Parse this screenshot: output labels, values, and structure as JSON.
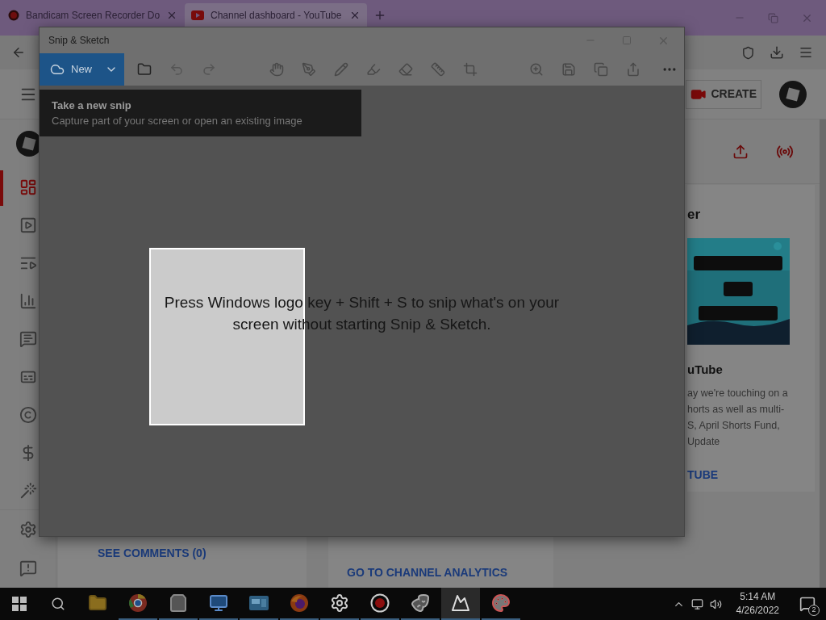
{
  "browser": {
    "tabs": [
      {
        "title": "Bandicam Screen Recorder Do",
        "kind": "record",
        "selected": false
      },
      {
        "title": "Channel dashboard - YouTube",
        "kind": "youtube",
        "selected": true
      }
    ]
  },
  "studio": {
    "create_button": "CREATE",
    "sidebar": [
      {
        "kind": "dashboard",
        "selected": true
      },
      {
        "kind": "content",
        "selected": false
      },
      {
        "kind": "playlists",
        "selected": false
      },
      {
        "kind": "analytics",
        "selected": false
      },
      {
        "kind": "comments",
        "selected": false
      },
      {
        "kind": "subtitles",
        "selected": false
      },
      {
        "kind": "copyright",
        "selected": false
      },
      {
        "kind": "earn",
        "selected": false
      },
      {
        "kind": "customization",
        "selected": false
      }
    ],
    "sidebar_bottom": [
      {
        "kind": "settings",
        "selected": false
      },
      {
        "kind": "feedback",
        "selected": false
      }
    ],
    "news_card": {
      "heading": "er",
      "video_title": "uTube",
      "lines": [
        "ay we're touching on a",
        "horts as well as multi-",
        "S, April Shorts Fund,",
        "Update"
      ],
      "link": "TUBE"
    },
    "comments_link": "SEE COMMENTS (0)",
    "analytics_link": "GO TO CHANNEL ANALYTICS"
  },
  "snip": {
    "title": "Snip & Sketch",
    "new_label": "New",
    "tooltip": {
      "title": "Take a new snip",
      "description": "Capture part of your screen or open an existing image"
    },
    "message": "Press Windows logo key + Shift + S to snip what's on your screen without starting Snip & Sketch."
  },
  "taskbar": {
    "apps": [
      {
        "kind": "folder",
        "running": false,
        "selected": false
      },
      {
        "kind": "browser",
        "running": true,
        "selected": false
      },
      {
        "kind": "store",
        "running": true,
        "selected": false
      },
      {
        "kind": "remote",
        "running": true,
        "selected": false
      },
      {
        "kind": "window",
        "running": true,
        "selected": false
      },
      {
        "kind": "fox",
        "running": true,
        "selected": false
      },
      {
        "kind": "settings",
        "running": true,
        "selected": false
      },
      {
        "kind": "recorder",
        "running": true,
        "selected": false
      },
      {
        "kind": "theater",
        "running": true,
        "selected": false
      },
      {
        "kind": "snip",
        "running": true,
        "selected": true
      },
      {
        "kind": "paint",
        "running": true,
        "selected": false
      }
    ],
    "time": "5:14 AM",
    "date": "4/26/2022",
    "notifications": "2"
  }
}
